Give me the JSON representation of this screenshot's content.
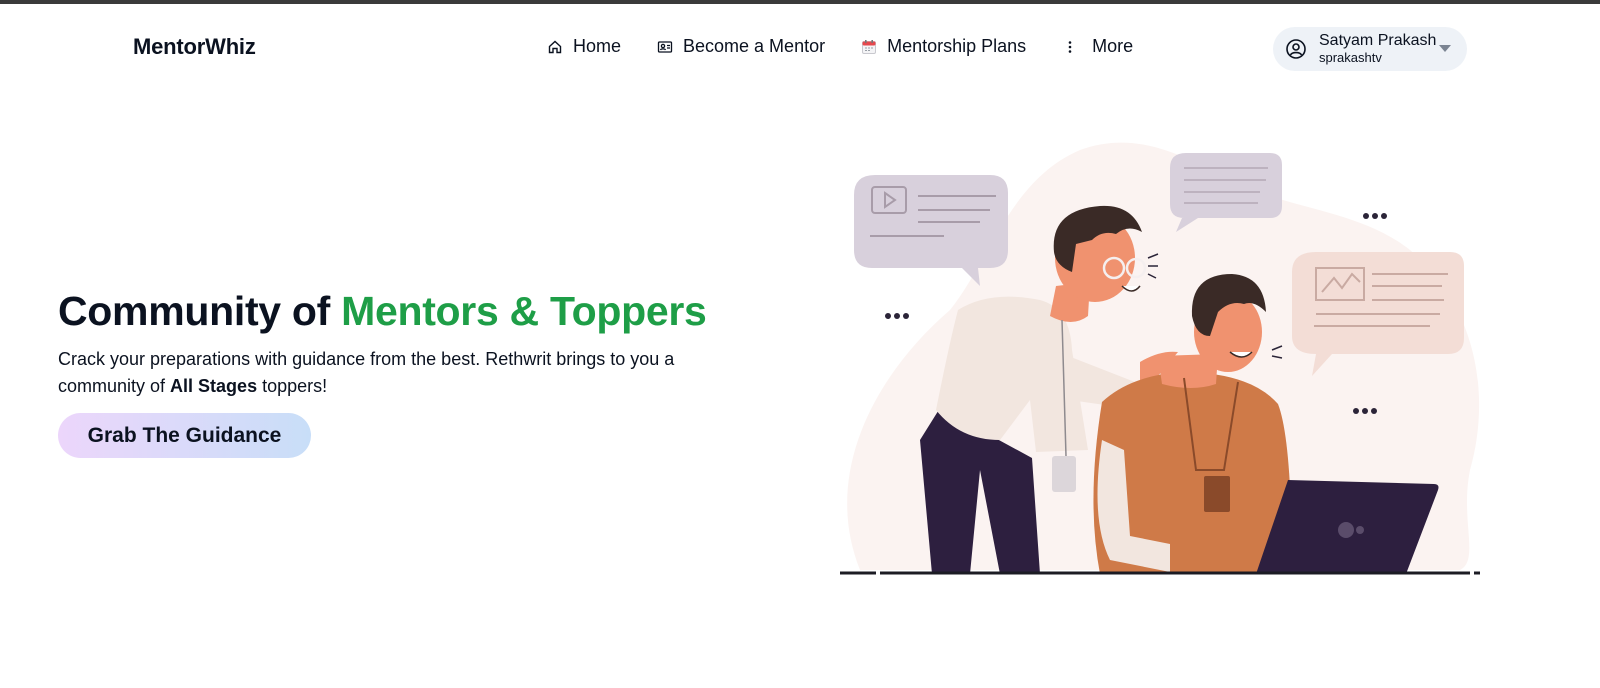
{
  "brand": {
    "name": "MentorWhiz"
  },
  "nav": {
    "items": [
      {
        "label": "Home",
        "icon": "home-icon"
      },
      {
        "label": "Become a Mentor",
        "icon": "id-card-icon"
      },
      {
        "label": "Mentorship Plans",
        "icon": "calendar-icon"
      },
      {
        "label": "More",
        "icon": "kebab-vertical-icon"
      }
    ]
  },
  "user": {
    "name": "Satyam Prakash",
    "handle": "sprakashtv",
    "icon": "user-circle-icon"
  },
  "hero": {
    "title_prefix": "Community of ",
    "title_accent": "Mentors & Toppers",
    "desc_part1": "Crack your preparations with guidance from the best. Rethwrit brings to you a community of ",
    "desc_bold": "All Stages",
    "desc_part2": " toppers!",
    "cta_label": "Grab The Guidance"
  },
  "colors": {
    "accent_green": "#1e9e47",
    "text_dark": "#0b1220",
    "pill_bg": "#eef2f7"
  }
}
